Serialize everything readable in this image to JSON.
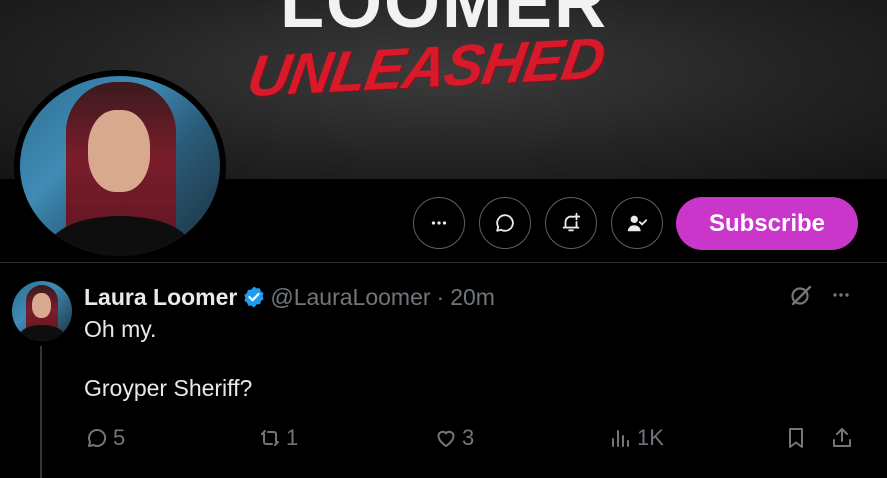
{
  "banner": {
    "title": "LOOMER",
    "subtitle": "UNLEASHED"
  },
  "profile_actions": {
    "more_icon": "more-icon",
    "message_icon": "message-icon",
    "notify_icon": "bell-plus-icon",
    "following_icon": "person-check-icon",
    "subscribe_label": "Subscribe"
  },
  "colors": {
    "subscribe_bg": "#c936c9",
    "verified": "#1d9bf0",
    "muted": "#71767b"
  },
  "tweet": {
    "display_name": "Laura Loomer",
    "handle": "@LauraLoomer",
    "separator": "·",
    "time": "20m",
    "line1": "Oh my.",
    "line2": "Groyper Sheriff?",
    "stats": {
      "replies": "5",
      "reposts": "1",
      "likes": "3",
      "views": "1K"
    }
  }
}
